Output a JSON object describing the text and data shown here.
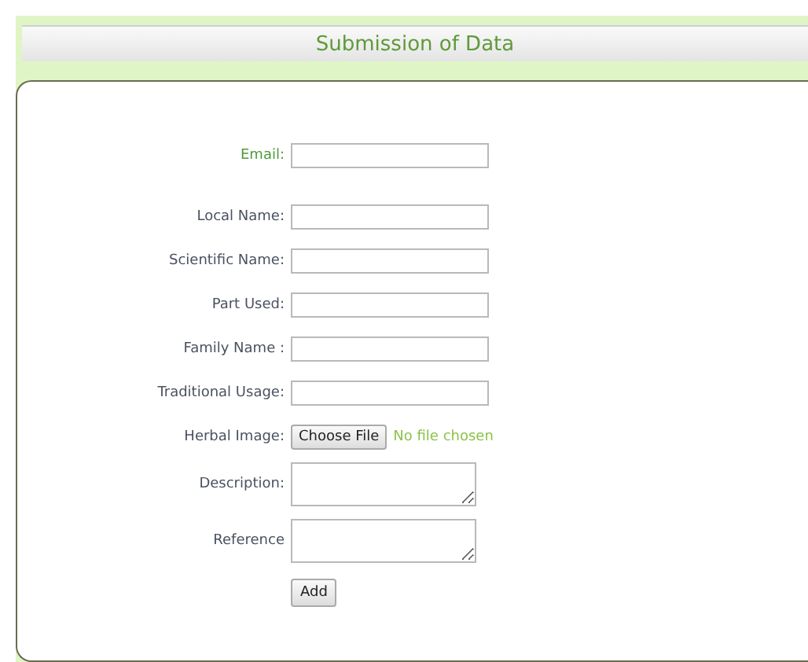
{
  "title": "Submission of Data",
  "fields": [
    {
      "kind": "text",
      "label": "Email:",
      "highlighted": true
    },
    {
      "kind": "text",
      "label": "Local Name:",
      "highlighted": false
    },
    {
      "kind": "text",
      "label": "Scientific Name:",
      "highlighted": false
    },
    {
      "kind": "text",
      "label": "Part Used:",
      "highlighted": false
    },
    {
      "kind": "text",
      "label": "Family Name :",
      "highlighted": false
    },
    {
      "kind": "text",
      "label": "Traditional Usage:",
      "highlighted": false
    },
    {
      "kind": "file",
      "label": "Herbal Image:",
      "highlighted": false,
      "button": "Choose File",
      "status": "No file chosen"
    },
    {
      "kind": "textarea",
      "label": "Description:",
      "highlighted": false
    },
    {
      "kind": "textarea",
      "label": "Reference",
      "highlighted": false
    }
  ],
  "submit": "Add"
}
